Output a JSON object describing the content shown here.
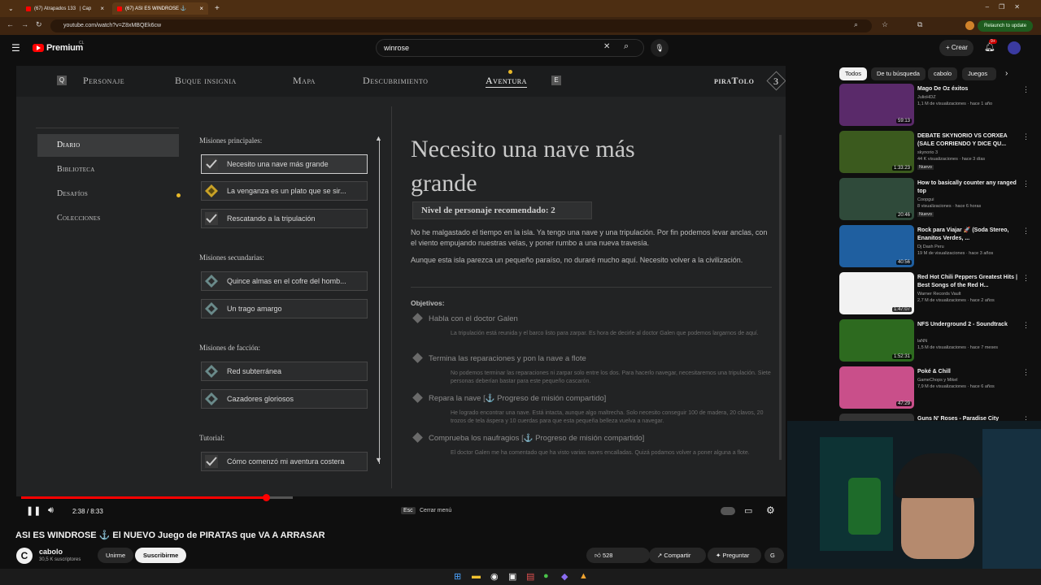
{
  "browser": {
    "tabs": [
      {
        "label": "(67) Atrapados 133"
      },
      {
        "label": "| Cap"
      },
      {
        "label": "(67) ASI ES WINDROSE ⚓"
      }
    ],
    "url": "youtube.com/watch?v=Z8xMBQEk6cw",
    "relaunch": "Relaunch to update"
  },
  "youtube": {
    "logo": "Premium",
    "region": "CL",
    "search_value": "winrose",
    "create_label": "Crear",
    "notif_count": "9+"
  },
  "game": {
    "nav": [
      "Personaje",
      "Buque insignia",
      "Mapa",
      "Descubrimiento",
      "Aventura"
    ],
    "nav_key_left": "Q",
    "nav_key_right": "E",
    "player": "piraTolo",
    "level": "3",
    "sidebar": [
      "Diario",
      "Biblioteca",
      "Desafíos",
      "Colecciones"
    ],
    "sections": {
      "main": "Misiones principales:",
      "secondary": "Misiones secundarias:",
      "faction": "Misiones de facción:",
      "tutorial": "Tutorial:"
    },
    "quests_main": [
      "Necesito una nave más grande",
      "La venganza es un plato que se sir...",
      "Rescatando a la tripulación"
    ],
    "quests_secondary": [
      "Quince almas en el cofre del homb...",
      "Un trago amargo"
    ],
    "quests_faction": [
      "Red subterránea",
      "Cazadores gloriosos"
    ],
    "quests_tutorial": [
      "Cómo comenzó mi aventura costera"
    ],
    "detail": {
      "title_line1": "Necesito una nave más",
      "title_line2": "grande",
      "level_label": "Nivel de personaje recomendado: 2",
      "para1": "No he malgastado el tiempo en la isla. Ya tengo una nave y una tripulación. Por fin podemos levar anclas, con el viento empujando nuestras velas, y poner rumbo a una nueva travesía.",
      "para2": "Aunque esta isla parezca un pequeño paraíso, no duraré mucho aquí. Necesito volver a la civilización.",
      "objectives_label": "Objetivos:",
      "objectives": [
        {
          "title": "Habla con el doctor Galen",
          "desc": "La tripulación está reunida y el barco listo para zarpar. Es hora de decirle al doctor Galen que podemos largarnos de aquí."
        },
        {
          "title": "Termina las reparaciones y pon la nave a flote",
          "desc": "No podemos terminar las reparaciones ni zarpar solo entre los dos. Para hacerlo navegar, necesitaremos una tripulación. Siete personas deberían bastar para este pequeño cascarón."
        },
        {
          "title": "Repara la nave [⚓ Progreso de misión compartido]",
          "desc": "He logrado encontrar una nave. Está intacta, aunque algo maltrecha. Solo necesito conseguir 100 de madera, 20 clavos, 20 trozos de tela áspera y 10 cuerdas para que esta pequeña belleza vuelva a navegar."
        },
        {
          "title": "Comprueba los naufragios [⚓ Progreso de misión compartido]",
          "desc": "El doctor Galen me ha comentado que ha visto varias naves encalladas. Quizá podamos volver a poner alguna a flote."
        }
      ]
    }
  },
  "player": {
    "time": "2:38 / 8:33",
    "progress": 0.32,
    "esc_key": "Esc",
    "esc_label": "Cerrar menú"
  },
  "video": {
    "title": "ASI ES WINDROSE ⚓ El NUEVO Juego de PIRATAS que VA A ARRASAR",
    "channel": "cabolo",
    "subs": "30,5 K suscriptores",
    "join": "Unirme",
    "subscribe": "Suscribirme",
    "likes": "528",
    "share": "Compartir",
    "ask": "Preguntar"
  },
  "chips": [
    "Todos",
    "De tu búsqueda",
    "cabolo",
    "Juegos d"
  ],
  "related": [
    {
      "title": "Mago De Oz éxitos",
      "channel": "JulioHDZ",
      "meta": "1,1 M de visualizaciones · hace 1 año",
      "duration": "59:13",
      "color": "#5a2a6a"
    },
    {
      "title": "DEBATE SKYNORIO VS CORXEA (SALE CORRIENDO Y DICE QU...",
      "channel": "skynorio 3",
      "meta": "44 K visualizaciones · hace 3 días",
      "duration": "1:33:23",
      "color": "#3b5a1e",
      "badge": "Nuevo"
    },
    {
      "title": "How to basically counter any ranged top",
      "channel": "Coopgui",
      "meta": "8 visualizaciones · hace 6 horas",
      "duration": "20:46",
      "color": "#2f4a3a",
      "badge": "Nuevo"
    },
    {
      "title": "Rock para Viajar 🚀 (Soda Stereo, Enanitos Verdes, ...",
      "channel": "Dj Dash Peru",
      "meta": "19 M de visualizaciones · hace 3 años",
      "duration": "40:56",
      "color": "#1f5fa0"
    },
    {
      "title": "Red Hot Chili Peppers Greatest Hits | Best Songs of the Red H...",
      "channel": "Warner Records Vault",
      "meta": "2,7 M de visualizaciones · hace 2 años",
      "duration": "1:47:07",
      "color": "#f2f2f2"
    },
    {
      "title": "NFS Underground 2 - Soundtrack",
      "channel": "laNN",
      "meta": "1,5 M de visualizaciones · hace 7 meses",
      "duration": "1:52:31",
      "color": "#2d6a1f"
    },
    {
      "title": "Poké & Chill",
      "channel": "GameChops y Mikel",
      "meta": "7,9 M de visualizaciones · hace 6 años",
      "duration": "47:29",
      "color": "#c94f8a"
    },
    {
      "title": "Guns N' Roses - Paradise City",
      "channel": "",
      "meta": "",
      "duration": "",
      "color": "#333"
    }
  ]
}
